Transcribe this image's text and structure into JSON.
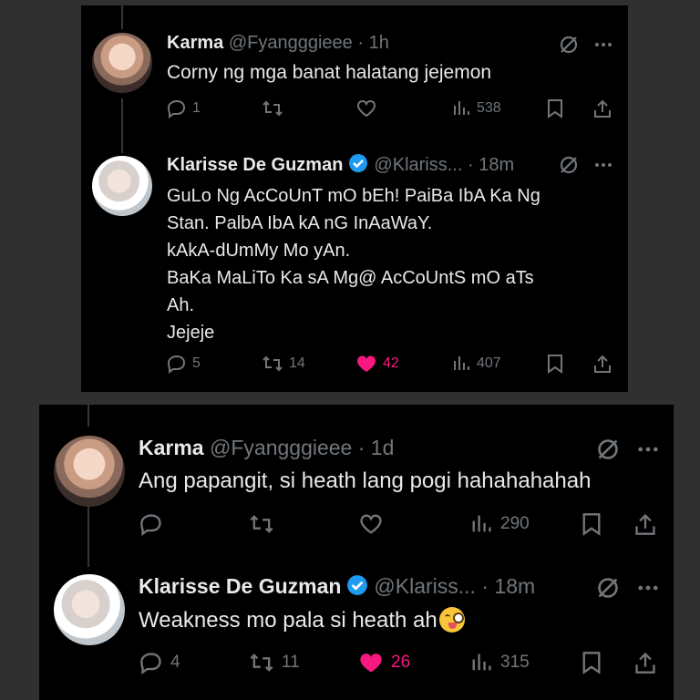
{
  "panel1": {
    "tweet1": {
      "name": "Karma",
      "handle": "@Fyangggieee",
      "sep": "·",
      "time": "1h",
      "text": "Corny ng mga banat halatang jejemon",
      "replies": "1",
      "retweets": "",
      "likes": "",
      "views": "538"
    },
    "tweet2": {
      "name": "Klarisse De Guzman",
      "handle": "@Klariss...",
      "sep": "·",
      "time": "18m",
      "lines": [
        "GuLo Ng AcCoUnT mO bEh! PaiBa IbA Ka Ng",
        "Stan. PalbA IbA kA nG InAaWaY.",
        "kAkA-dUmMy Mo yAn.",
        "BaKa MaLiTo Ka sA Mg@ AcCoUntS mO aTs",
        "Ah.",
        "Jejeje"
      ],
      "replies": "5",
      "retweets": "14",
      "likes": "42",
      "views": "407"
    }
  },
  "panel2": {
    "tweet1": {
      "name": "Karma",
      "handle": "@Fyangggieee",
      "sep": "·",
      "time": "1d",
      "text": "Ang papangit, si heath lang pogi hahahahahah",
      "replies": "",
      "retweets": "",
      "likes": "",
      "views": "290"
    },
    "tweet2": {
      "name": "Klarisse De Guzman",
      "handle": "@Klariss...",
      "sep": "·",
      "time": "18m",
      "text": "Weakness mo pala si heath ah",
      "emoji": "winking-face-with-tongue",
      "replies": "4",
      "retweets": "11",
      "likes": "26",
      "views": "315"
    }
  },
  "colors": {
    "background": "#000000",
    "text": "#e7e9ea",
    "muted": "#71767b",
    "like": "#f91880",
    "verified": "#1d9bf0"
  }
}
